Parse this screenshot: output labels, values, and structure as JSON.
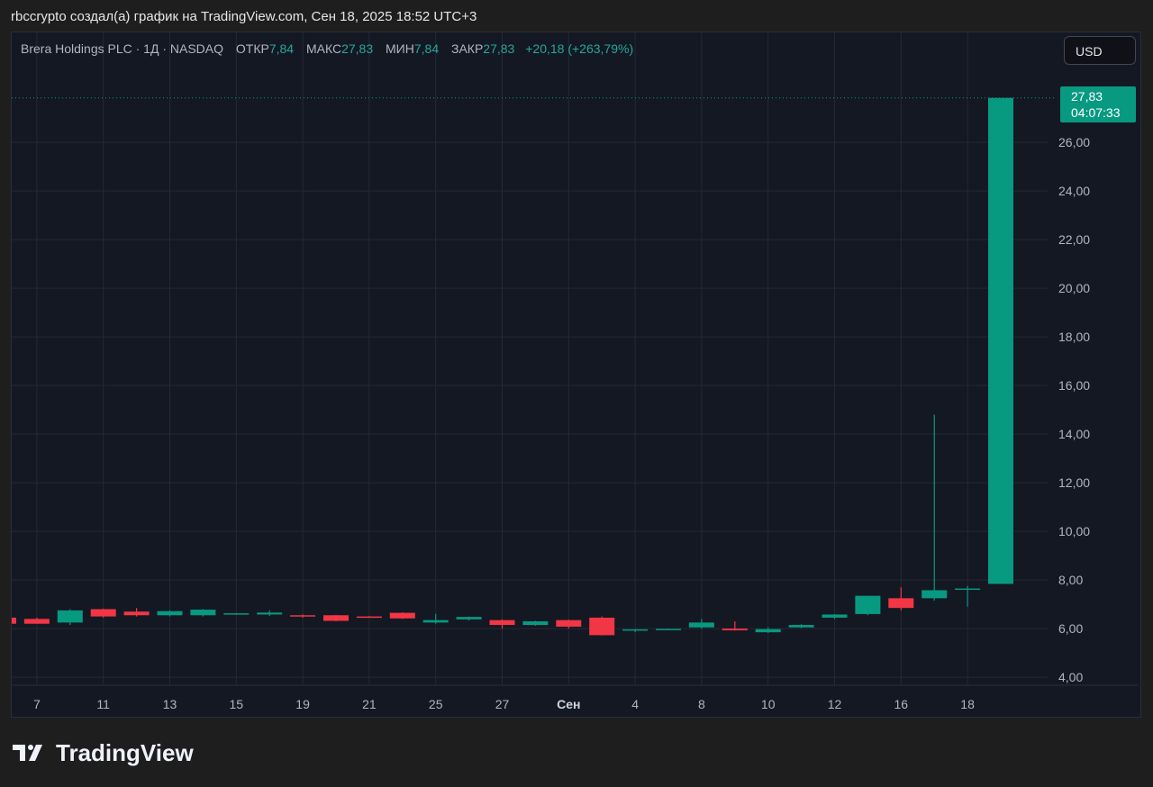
{
  "header": {
    "credit": "rbccrypto создал(а) график на TradingView.com, Сен 18, 2025 18:52 UTC+3"
  },
  "legend": {
    "symbol": "Brera Holdings PLC · 1Д · NASDAQ",
    "open_label": "ОТКР",
    "open_value": "7,84",
    "high_label": "МАКС",
    "high_value": "27,83",
    "low_label": "МИН",
    "low_value": "7,84",
    "close_label": "ЗАКР",
    "close_value": "27,83",
    "change": "+20,18 (+263,79%)"
  },
  "currency_button": "USD",
  "price_tag": {
    "price": "27,83",
    "countdown": "04:07:33"
  },
  "brand": {
    "name": "TradingView"
  },
  "colors": {
    "up": "#089981",
    "down": "#f23645",
    "background": "#141823",
    "grid": "#242936"
  },
  "chart_data": {
    "type": "candlestick",
    "ylim": [
      3.5,
      28.5
    ],
    "y_ticks": [
      "4,00",
      "6,00",
      "8,00",
      "10,00",
      "12,00",
      "14,00",
      "16,00",
      "18,00",
      "20,00",
      "22,00",
      "24,00",
      "26,00"
    ],
    "y_tick_values": [
      4,
      6,
      8,
      10,
      12,
      14,
      16,
      18,
      20,
      22,
      24,
      26
    ],
    "x_ticks": [
      "7",
      "11",
      "13",
      "15",
      "19",
      "21",
      "25",
      "27",
      "Сен",
      "4",
      "8",
      "10",
      "12",
      "16",
      "18"
    ],
    "x_tick_index": [
      1,
      3,
      5,
      7,
      9,
      11,
      13,
      15,
      17,
      19,
      21,
      23,
      25,
      27,
      29
    ],
    "last_price": 27.83,
    "candles": [
      {
        "o": 6.45,
        "h": 6.45,
        "l": 6.2,
        "c": 6.2
      },
      {
        "o": 6.4,
        "h": 6.45,
        "l": 6.2,
        "c": 6.2
      },
      {
        "o": 6.25,
        "h": 6.8,
        "l": 6.15,
        "c": 6.75
      },
      {
        "o": 6.8,
        "h": 6.82,
        "l": 6.45,
        "c": 6.5
      },
      {
        "o": 6.7,
        "h": 6.85,
        "l": 6.5,
        "c": 6.55
      },
      {
        "o": 6.55,
        "h": 6.75,
        "l": 6.5,
        "c": 6.72
      },
      {
        "o": 6.55,
        "h": 6.8,
        "l": 6.5,
        "c": 6.78
      },
      {
        "o": 6.62,
        "h": 6.64,
        "l": 6.58,
        "c": 6.63
      },
      {
        "o": 6.58,
        "h": 6.75,
        "l": 6.52,
        "c": 6.66
      },
      {
        "o": 6.55,
        "h": 6.58,
        "l": 6.45,
        "c": 6.5
      },
      {
        "o": 6.55,
        "h": 6.56,
        "l": 6.3,
        "c": 6.32
      },
      {
        "o": 6.5,
        "h": 6.52,
        "l": 6.45,
        "c": 6.47
      },
      {
        "o": 6.65,
        "h": 6.67,
        "l": 6.4,
        "c": 6.42
      },
      {
        "o": 6.25,
        "h": 6.6,
        "l": 6.2,
        "c": 6.35
      },
      {
        "o": 6.38,
        "h": 6.5,
        "l": 6.33,
        "c": 6.48
      },
      {
        "o": 6.35,
        "h": 6.38,
        "l": 6.0,
        "c": 6.15
      },
      {
        "o": 6.15,
        "h": 6.32,
        "l": 6.12,
        "c": 6.3
      },
      {
        "o": 6.35,
        "h": 6.37,
        "l": 6.0,
        "c": 6.08
      },
      {
        "o": 6.45,
        "h": 6.5,
        "l": 5.72,
        "c": 5.73
      },
      {
        "o": 5.95,
        "h": 5.98,
        "l": 5.85,
        "c": 5.97
      },
      {
        "o": 5.97,
        "h": 6.0,
        "l": 5.93,
        "c": 5.99
      },
      {
        "o": 6.05,
        "h": 6.4,
        "l": 6.0,
        "c": 6.25
      },
      {
        "o": 6.0,
        "h": 6.3,
        "l": 5.92,
        "c": 5.93
      },
      {
        "o": 5.85,
        "h": 6.05,
        "l": 5.82,
        "c": 5.98
      },
      {
        "o": 6.05,
        "h": 6.18,
        "l": 6.02,
        "c": 6.15
      },
      {
        "o": 6.45,
        "h": 6.6,
        "l": 6.4,
        "c": 6.58
      },
      {
        "o": 6.6,
        "h": 7.35,
        "l": 6.55,
        "c": 7.35
      },
      {
        "o": 7.25,
        "h": 7.7,
        "l": 6.75,
        "c": 6.85
      },
      {
        "o": 7.25,
        "h": 14.8,
        "l": 7.15,
        "c": 7.58
      },
      {
        "o": 7.65,
        "h": 7.75,
        "l": 6.9,
        "c": 7.65
      },
      {
        "o": 7.84,
        "h": 27.83,
        "l": 7.84,
        "c": 27.83
      }
    ]
  }
}
